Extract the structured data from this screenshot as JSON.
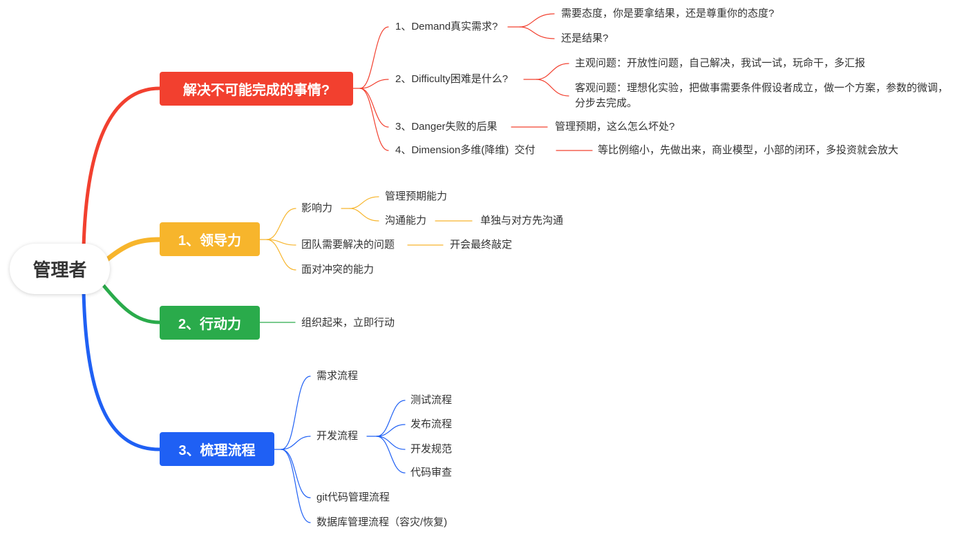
{
  "root": {
    "label": "管理者"
  },
  "branches": [
    {
      "label": "解决不可能完成的事情?",
      "color": "#F2402F",
      "children": [
        {
          "label": "1、Demand真实需求?",
          "children": [
            {
              "label": "需要态度，你是要拿结果，还是尊重你的态度?"
            },
            {
              "label": "还是结果?"
            }
          ]
        },
        {
          "label": "2、Difficulty困难是什么?",
          "children": [
            {
              "label": "主观问题：开放性问题，自己解决，我试一试，玩命干，多汇报"
            },
            {
              "label": "客观问题：理想化实验，把做事需要条件假设者成立，做一个方案，参数的微调，\n分步去完成。"
            }
          ]
        },
        {
          "label": "3、Danger失败的后果",
          "children": [
            {
              "label": "管理预期，这么怎么坏处?"
            }
          ]
        },
        {
          "label": "4、Dimension多维(降维)  交付",
          "children": [
            {
              "label": "等比例缩小，先做出来，商业模型，小部的闭环，多投资就会放大"
            }
          ]
        }
      ]
    },
    {
      "label": "1、领导力",
      "color": "#F7B52C",
      "children": [
        {
          "label": "影响力",
          "children": [
            {
              "label": "管理预期能力"
            },
            {
              "label": "沟通能力",
              "children": [
                {
                  "label": "单独与对方先沟通"
                }
              ]
            }
          ]
        },
        {
          "label": "团队需要解决的问题",
          "children": [
            {
              "label": "开会最终敲定"
            }
          ]
        },
        {
          "label": "面对冲突的能力"
        }
      ]
    },
    {
      "label": "2、行动力",
      "color": "#2AAB4B",
      "children": [
        {
          "label": "组织起来，立即行动"
        }
      ]
    },
    {
      "label": "3、梳理流程",
      "color": "#1F60F4",
      "children": [
        {
          "label": "需求流程"
        },
        {
          "label": "开发流程",
          "children": [
            {
              "label": "测试流程"
            },
            {
              "label": "发布流程"
            },
            {
              "label": "开发规范"
            },
            {
              "label": "代码审查"
            }
          ]
        },
        {
          "label": "git代码管理流程"
        },
        {
          "label": "数据库管理流程（容灾/恢复)"
        }
      ]
    }
  ]
}
